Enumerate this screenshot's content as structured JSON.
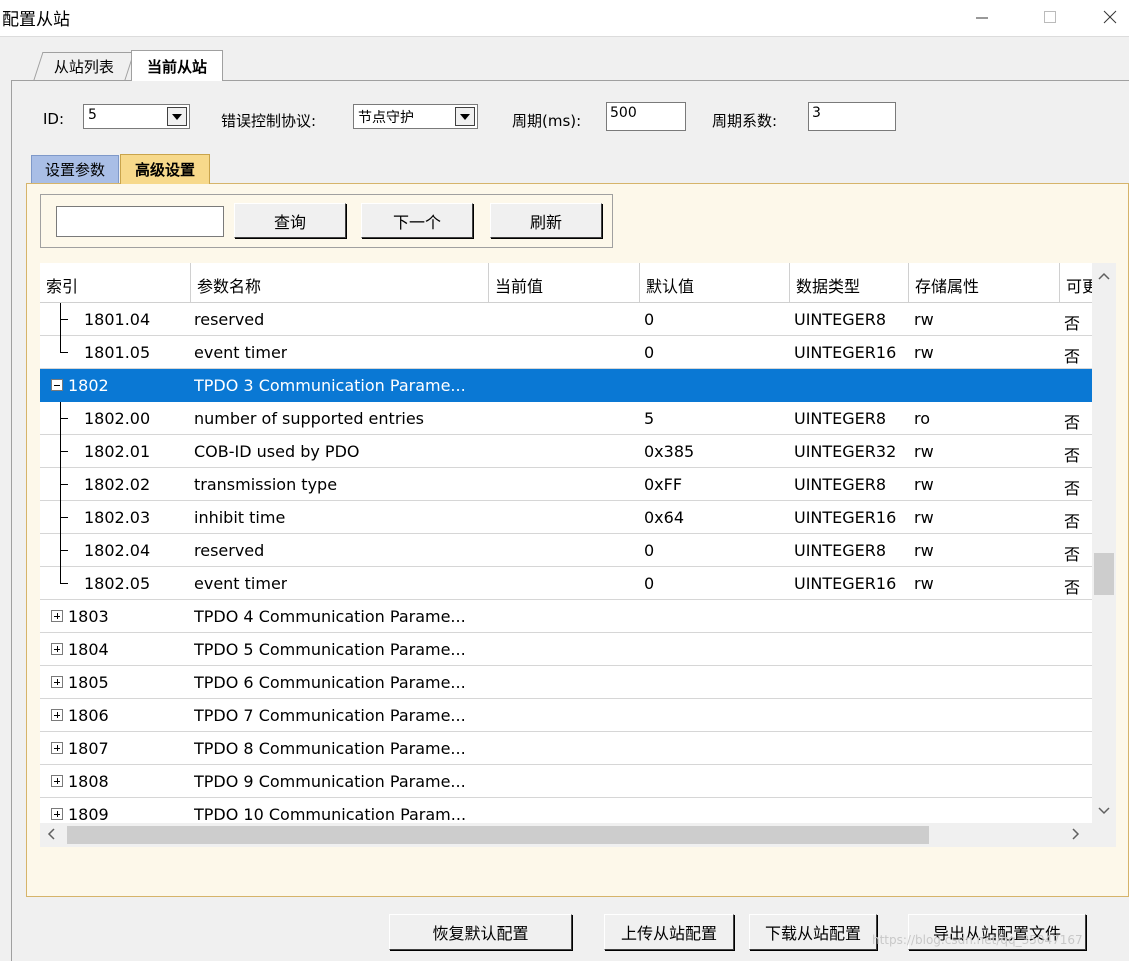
{
  "window": {
    "title": "配置从站"
  },
  "tabs_outer": [
    {
      "label": "从站列表"
    },
    {
      "label": "当前从站"
    }
  ],
  "top_row": {
    "id_label": "ID:",
    "id_value": "5",
    "protocol_label": "错误控制协议:",
    "protocol_value": "节点守护",
    "period_label": "周期(ms):",
    "period_value": "500",
    "factor_label": "周期系数:",
    "factor_value": "3"
  },
  "tabs_inner": [
    {
      "label": "设置参数"
    },
    {
      "label": "高级设置"
    }
  ],
  "search": {
    "query_value": "",
    "query_button": "查询",
    "next_button": "下一个",
    "refresh_button": "刷新"
  },
  "table": {
    "columns": [
      "索引",
      "参数名称",
      "当前值",
      "默认值",
      "数据类型",
      "存储属性",
      "可更"
    ],
    "rows": [
      {
        "index": "1801.04",
        "name": "reserved",
        "current": "",
        "default": "0",
        "type": "UINTEGER8",
        "access": "rw",
        "mod": "否"
      },
      {
        "index": "1801.05",
        "name": "event timer",
        "current": "",
        "default": "0",
        "type": "UINTEGER16",
        "access": "rw",
        "mod": "否"
      },
      {
        "index": "1802",
        "name": "TPDO 3 Communication Parame...",
        "current": "",
        "default": "",
        "type": "",
        "access": "",
        "mod": ""
      },
      {
        "index": "1802.00",
        "name": "number of supported entries",
        "current": "",
        "default": "5",
        "type": "UINTEGER8",
        "access": "ro",
        "mod": "否"
      },
      {
        "index": "1802.01",
        "name": "COB-ID used by PDO",
        "current": "",
        "default": "0x385",
        "type": "UINTEGER32",
        "access": "rw",
        "mod": "否"
      },
      {
        "index": "1802.02",
        "name": "transmission type",
        "current": "",
        "default": "0xFF",
        "type": "UINTEGER8",
        "access": "rw",
        "mod": "否"
      },
      {
        "index": "1802.03",
        "name": "inhibit time",
        "current": "",
        "default": "0x64",
        "type": "UINTEGER16",
        "access": "rw",
        "mod": "否"
      },
      {
        "index": "1802.04",
        "name": "reserved",
        "current": "",
        "default": "0",
        "type": "UINTEGER8",
        "access": "rw",
        "mod": "否"
      },
      {
        "index": "1802.05",
        "name": "event timer",
        "current": "",
        "default": "0",
        "type": "UINTEGER16",
        "access": "rw",
        "mod": "否"
      },
      {
        "index": "1803",
        "name": "TPDO 4 Communication Parame...",
        "current": "",
        "default": "",
        "type": "",
        "access": "",
        "mod": ""
      },
      {
        "index": "1804",
        "name": "TPDO 5 Communication Parame...",
        "current": "",
        "default": "",
        "type": "",
        "access": "",
        "mod": ""
      },
      {
        "index": "1805",
        "name": "TPDO 6 Communication Parame...",
        "current": "",
        "default": "",
        "type": "",
        "access": "",
        "mod": ""
      },
      {
        "index": "1806",
        "name": "TPDO 7 Communication Parame...",
        "current": "",
        "default": "",
        "type": "",
        "access": "",
        "mod": ""
      },
      {
        "index": "1807",
        "name": "TPDO 8 Communication Parame...",
        "current": "",
        "default": "",
        "type": "",
        "access": "",
        "mod": ""
      },
      {
        "index": "1808",
        "name": "TPDO 9 Communication Parame...",
        "current": "",
        "default": "",
        "type": "",
        "access": "",
        "mod": ""
      },
      {
        "index": "1809",
        "name": "TPDO 10 Communication Param...",
        "current": "",
        "default": "",
        "type": "",
        "access": "",
        "mod": ""
      }
    ]
  },
  "bottom_buttons": {
    "restore": "恢复默认配置",
    "upload": "上传从站配置",
    "download": "下载从站配置",
    "export": "导出从站配置文件"
  },
  "watermark": "https://blog.csdn.net/qq_35047167",
  "colors": {
    "selection": "#0a78d4",
    "tab_inactive_blue": "#a9bee6",
    "tab_active_yellow": "#f7d98b",
    "panel_bg": "#fdf8ea"
  }
}
